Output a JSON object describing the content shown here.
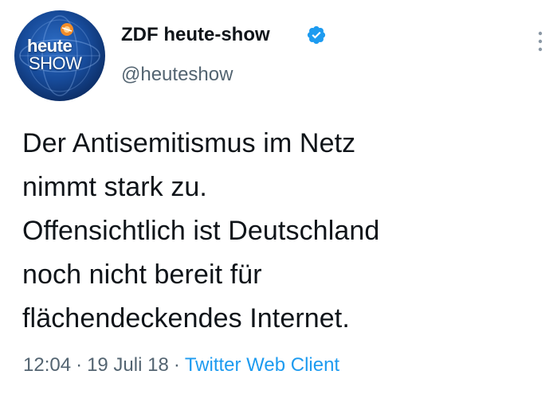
{
  "author": {
    "display_name": "ZDF heute-show",
    "handle": "@heuteshow",
    "verified": true,
    "avatar_icon": "heute-show-logo",
    "avatar_text_line1": "heute",
    "avatar_text_line2": "SHOW"
  },
  "tweet": {
    "lines": [
      "Der Antisemitismus im Netz",
      "nimmt stark zu.",
      "Offensichtlich ist Deutschland",
      "noch nicht bereit für",
      "flächendeckendes Internet."
    ]
  },
  "meta": {
    "time": "12:04",
    "separator": "·",
    "date": "19 Juli 18",
    "client": "Twitter Web Client"
  },
  "icons": {
    "verified": "verified-badge-icon",
    "more": "more-options-icon"
  },
  "colors": {
    "text": "#0f1419",
    "secondary": "#536471",
    "link": "#1d9bf0",
    "verified": "#1d9bf0",
    "avatar_bg": "#174b9a",
    "avatar_accent": "#f28c28"
  }
}
